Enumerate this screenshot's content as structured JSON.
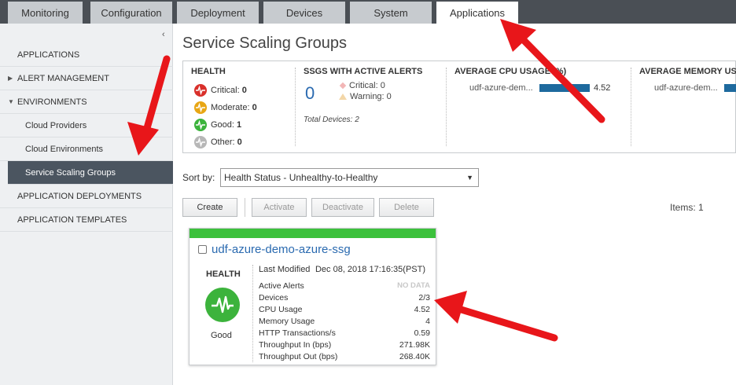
{
  "tabs": [
    {
      "label": "Monitoring",
      "active": false
    },
    {
      "label": "Configuration",
      "active": false
    },
    {
      "label": "Deployment",
      "active": false
    },
    {
      "label": "Devices",
      "active": false
    },
    {
      "label": "System",
      "active": false
    },
    {
      "label": "Applications",
      "active": true
    }
  ],
  "sidebar": {
    "collapse_icon": "chevron-left-icon",
    "items": [
      {
        "label": "APPLICATIONS"
      },
      {
        "label": "ALERT MANAGEMENT"
      },
      {
        "label": "ENVIRONMENTS"
      },
      {
        "label": "Cloud Providers"
      },
      {
        "label": "Cloud Environments"
      },
      {
        "label": "Service Scaling Groups",
        "selected": true
      },
      {
        "label": "APPLICATION DEPLOYMENTS"
      },
      {
        "label": "APPLICATION TEMPLATES"
      }
    ]
  },
  "page": {
    "title": "Service Scaling Groups"
  },
  "summary": {
    "health": {
      "heading": "HEALTH",
      "rows": [
        {
          "label": "Critical:",
          "count": "0",
          "color": "#d9302b"
        },
        {
          "label": "Moderate:",
          "count": "0",
          "color": "#e8a614"
        },
        {
          "label": "Good:",
          "count": "1",
          "color": "#3cb33c"
        },
        {
          "label": "Other:",
          "count": "0",
          "color": "#b7b7b7"
        }
      ]
    },
    "alerts": {
      "heading": "SSGS WITH ACTIVE ALERTS",
      "count": "0",
      "critical": "Critical: 0",
      "warning": "Warning: 0",
      "total_devices": "Total Devices: 2"
    },
    "cpu": {
      "heading": "AVERAGE CPU USAGE (%)",
      "label": "udf-azure-dem...",
      "value": "4.52"
    },
    "memory": {
      "heading": "AVERAGE MEMORY USAGE",
      "label": "udf-azure-dem..."
    }
  },
  "sort": {
    "label": "Sort by:",
    "selected": "Health Status - Unhealthy-to-Healthy"
  },
  "buttons": {
    "create": "Create",
    "activate": "Activate",
    "deactivate": "Deactivate",
    "delete": "Delete"
  },
  "items_count": "Items: 1",
  "card": {
    "title": "udf-azure-demo-azure-ssg",
    "status_color": "#3cc13c",
    "health_label": "HEALTH",
    "health_status": "Good",
    "last_modified_label": "Last Modified",
    "last_modified_value": "Dec 08, 2018 17:16:35(PST)",
    "rows": [
      {
        "k": "Active Alerts",
        "v": "NO DATA"
      },
      {
        "k": "Devices",
        "v": "2/3"
      },
      {
        "k": "CPU Usage",
        "v": "4.52"
      },
      {
        "k": "Memory Usage",
        "v": "4"
      },
      {
        "k": "HTTP Transactions/s",
        "v": "0.59"
      },
      {
        "k": "Throughput In (bps)",
        "v": "271.98K"
      },
      {
        "k": "Throughput Out (bps)",
        "v": "268.40K"
      }
    ]
  }
}
